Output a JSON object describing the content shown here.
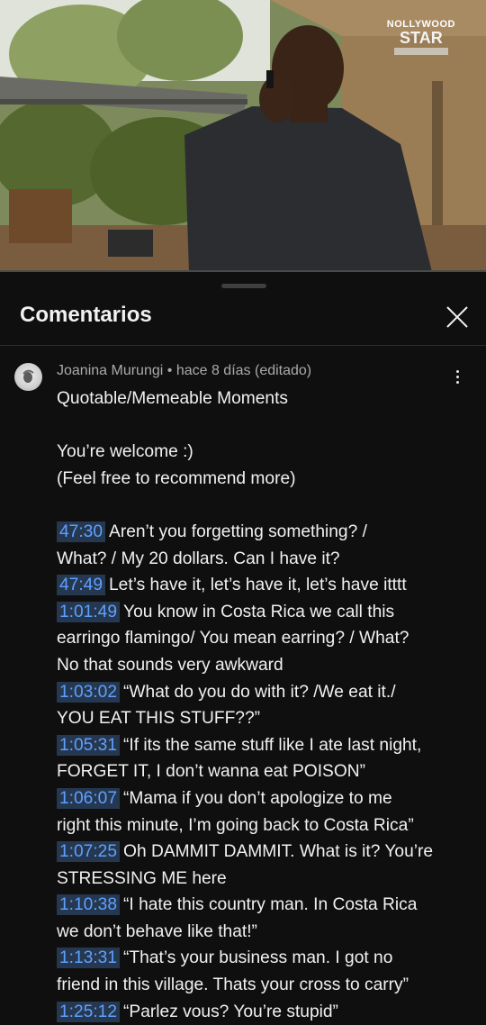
{
  "video": {
    "watermark": {
      "line1": "NOLLYWOOD",
      "line2": "STAR"
    }
  },
  "comments_panel": {
    "title": "Comentarios",
    "comment": {
      "author": "Joanina Murungi",
      "separator": "•",
      "time": "hace 8 días (editado)",
      "title_line": "Quotable/Memeable Moments",
      "intro_line1": "You’re welcome :)",
      "intro_line2": "(Feel free to recommend more)",
      "entries": [
        {
          "timestamp": "47:30",
          "lines": [
            "Aren’t you forgetting something? /",
            "What? / My 20 dollars. Can I have it?"
          ]
        },
        {
          "timestamp": "47:49",
          "lines": [
            "Let’s have it, let’s have it, let’s have itttt"
          ]
        },
        {
          "timestamp": "1:01:49",
          "lines": [
            "You know in Costa Rica we call this",
            "earringo flamingo/ You mean earring? / What?",
            "No that sounds very awkward"
          ]
        },
        {
          "timestamp": "1:03:02",
          "lines": [
            "“What do you do with it?  /We eat it./",
            "YOU EAT THIS STUFF??”"
          ]
        },
        {
          "timestamp": "1:05:31",
          "lines": [
            "“If its the same stuff like I ate last night,",
            "FORGET IT, I don’t wanna eat POISON”"
          ]
        },
        {
          "timestamp": "1:06:07",
          "lines": [
            "“Mama if you don’t apologize to me",
            "right this minute, I’m going back to Costa Rica”"
          ]
        },
        {
          "timestamp": "1:07:25",
          "lines": [
            "Oh DAMMIT DAMMIT. What is it? You’re",
            "STRESSING ME here"
          ]
        },
        {
          "timestamp": "1:10:38",
          "lines": [
            "“I hate this country man. In Costa Rica",
            "we don’t behave like that!”"
          ]
        },
        {
          "timestamp": "1:13:31",
          "lines": [
            "“That’s your business man. I got no",
            "friend in this village. Thats your cross to carry”"
          ]
        },
        {
          "timestamp": "1:25:12",
          "lines": [
            "“Parlez vous? You’re stupid”"
          ]
        }
      ]
    }
  },
  "icons": {
    "close": "close-icon",
    "more": "more-vert-icon",
    "avatar": "avatar"
  }
}
